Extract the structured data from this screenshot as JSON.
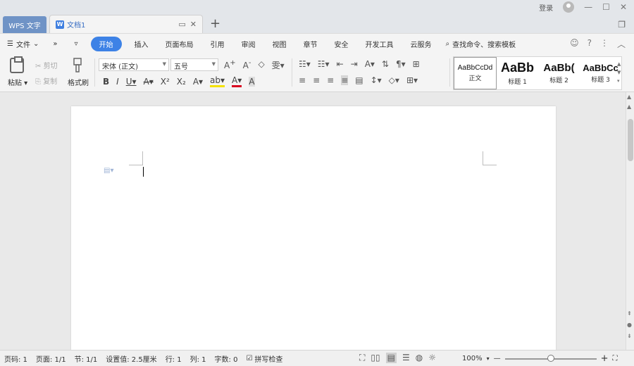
{
  "titlebar": {
    "app_tab": "WPS 文字",
    "doc_tab": "文档1",
    "login": "登录"
  },
  "menu": {
    "file": "文件",
    "items": [
      "开始",
      "插入",
      "页面布局",
      "引用",
      "审阅",
      "视图",
      "章节",
      "安全",
      "开发工具",
      "云服务"
    ],
    "active_index": 0,
    "search": "查找命令、搜索模板"
  },
  "ribbon": {
    "paste": "粘贴",
    "cut": "剪切",
    "copy": "复制",
    "format_painter": "格式刷",
    "font": "宋体 (正文)",
    "size": "五号"
  },
  "styles": [
    {
      "sample": "AaBbCcDd",
      "label": "正文"
    },
    {
      "sample": "AaBb",
      "label": "标题 1"
    },
    {
      "sample": "AaBb(",
      "label": "标题 2"
    },
    {
      "sample": "AaBbCc",
      "label": "标题 3"
    }
  ],
  "status": {
    "page_num": "页码: 1",
    "pages": "页面: 1/1",
    "section": "节: 1/1",
    "setting": "设置值: 2.5厘米",
    "row": "行: 1",
    "col": "列: 1",
    "word_count": "字数: 0",
    "spell_check": "拼写检查",
    "zoom": "100%",
    "zoom_fraction": 0.5
  },
  "colors": {
    "accent": "#3d82e6",
    "app_tab": "#6f93c6"
  }
}
